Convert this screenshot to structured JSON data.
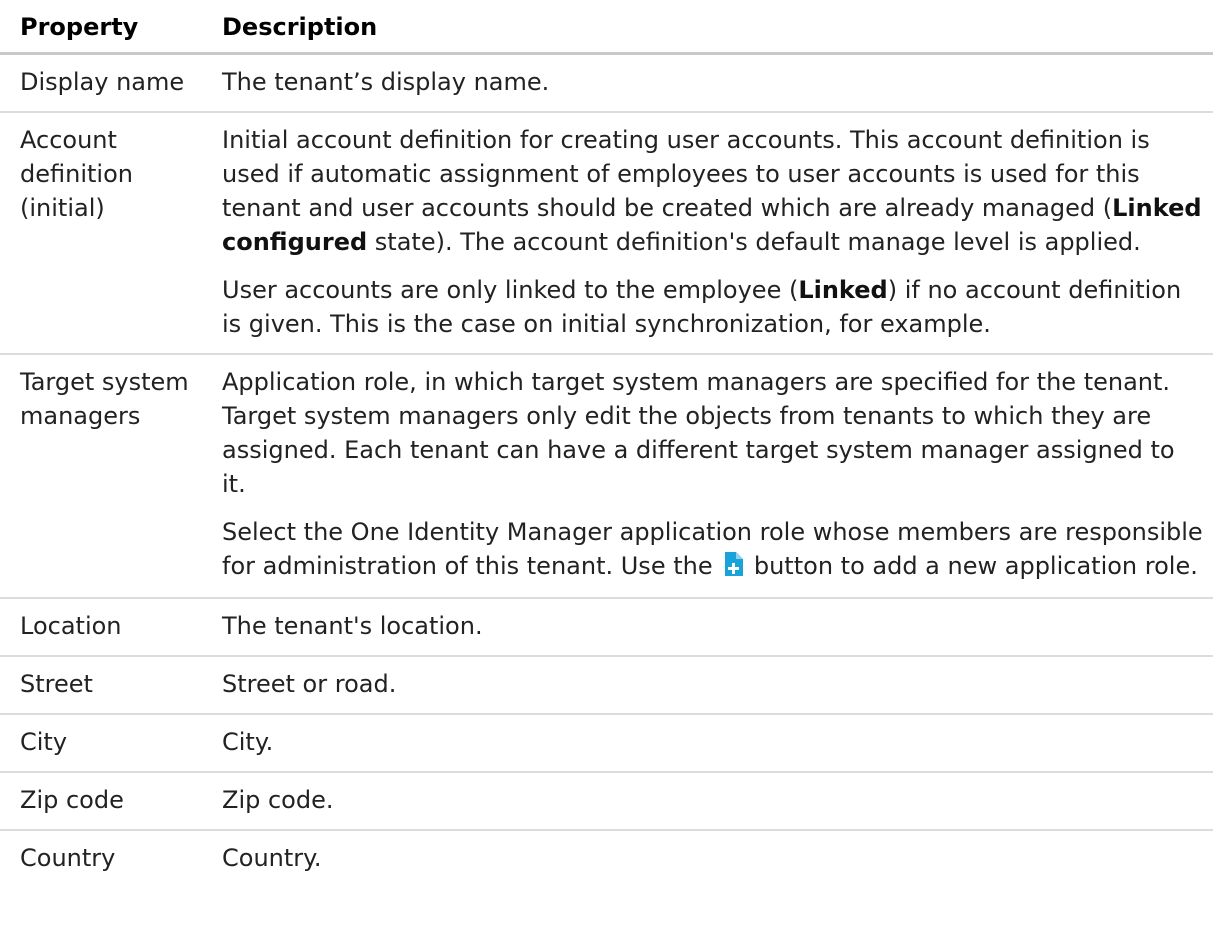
{
  "header": {
    "property": "Property",
    "description": "Description"
  },
  "rows": [
    {
      "property": "Display name",
      "description": "The tenant’s display name."
    },
    {
      "property": "Account definition (initial)",
      "p1a": "Initial account definition for creating user accounts. This account definition is used if automatic assignment of employees to user accounts is used for this tenant and user accounts should be created which are already managed (",
      "p1b": "Linked configured",
      "p1c": " state). The account definition's default manage level is applied.",
      "p2a": "User accounts are only linked to the employee (",
      "p2b": "Linked",
      "p2c": ") if no account definition is given. This is the case on initial synchronization, for example."
    },
    {
      "property": "Target system managers",
      "p1": "Application role, in which target system managers are specified for the tenant. Target system managers only edit the objects from tenants to which they are assigned. Each tenant can have a different target system manager assigned to it.",
      "p2a": "Select the One Identity Manager application role whose members are responsible for administration of this tenant. Use the",
      "p2b": "button to add a new application role."
    },
    {
      "property": "Location",
      "description": "The tenant's location."
    },
    {
      "property": "Street",
      "description": "Street or road."
    },
    {
      "property": "City",
      "description": "City."
    },
    {
      "property": "Zip code",
      "description": "Zip code."
    },
    {
      "property": "Country",
      "description": "Country."
    }
  ],
  "icons": {
    "add_button": "add-new-icon",
    "add_color": "#1aa3d9"
  }
}
